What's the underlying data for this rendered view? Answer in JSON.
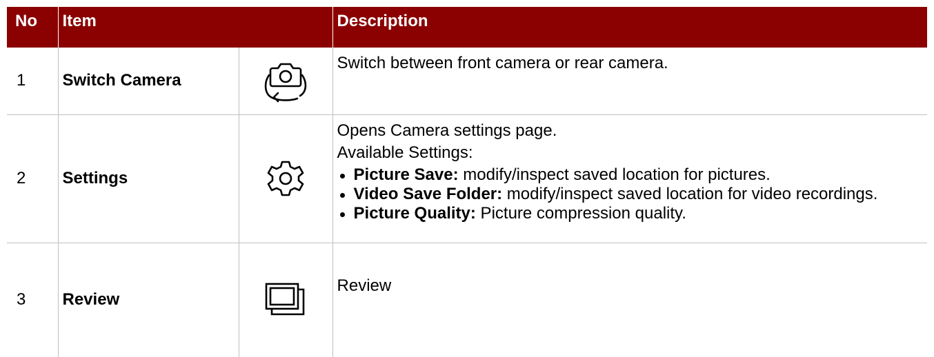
{
  "table": {
    "header": {
      "no": "No",
      "item": "Item",
      "description": "Description"
    },
    "rows": [
      {
        "no": "1",
        "item": "Switch Camera",
        "icon": "switch-camera-icon",
        "description": "Switch between front camera or rear camera."
      },
      {
        "no": "2",
        "item": "Settings",
        "icon": "gear-icon",
        "description_lines": [
          "Opens Camera settings page.",
          "Available Settings:"
        ],
        "bullets": [
          {
            "term": "Picture Save:",
            "text": " modify/inspect saved location for pictures."
          },
          {
            "term": "Video Save Folder:",
            "text": " modify/inspect saved location for video recordings."
          },
          {
            "term": "Picture Quality:",
            "text": " Picture compression quality."
          }
        ]
      },
      {
        "no": "3",
        "item": "Review",
        "icon": "gallery-icon",
        "description": "Review"
      }
    ]
  },
  "colors": {
    "header_background": "#8b0000",
    "header_text": "#ffffff",
    "grid_line": "#bfbfbf"
  }
}
